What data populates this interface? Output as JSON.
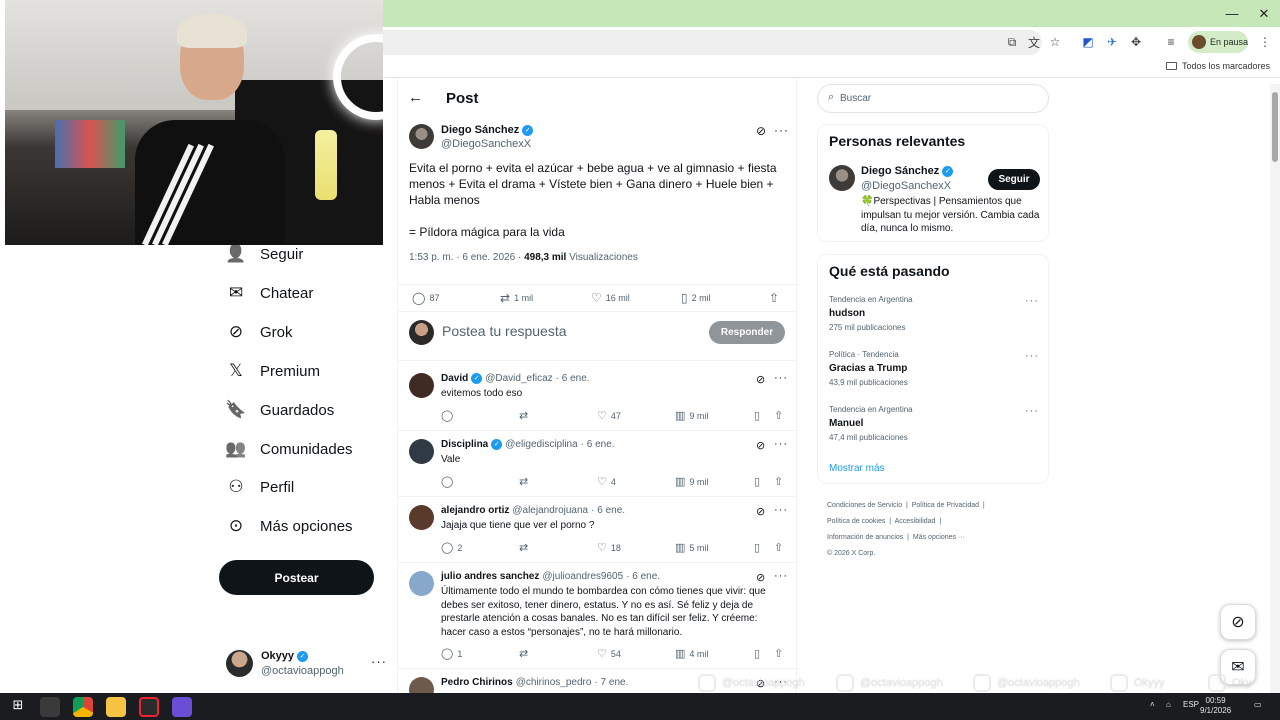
{
  "browser": {
    "profile_status": "En pausa",
    "bookmarks_all": "Todos los marcadores",
    "window_min": "—",
    "window_restore": "❐",
    "window_close": "✕"
  },
  "nav": {
    "items": [
      {
        "label": "Seguir",
        "icon": "add-person-icon"
      },
      {
        "label": "Chatear",
        "icon": "mail-icon"
      },
      {
        "label": "Grok",
        "icon": "grok-icon"
      },
      {
        "label": "Premium",
        "icon": "x-logo-icon"
      },
      {
        "label": "Guardados",
        "icon": "bookmark-icon"
      },
      {
        "label": "Comunidades",
        "icon": "communities-icon"
      },
      {
        "label": "Perfil",
        "icon": "person-icon"
      },
      {
        "label": "Más opciones",
        "icon": "more-circle-icon"
      }
    ],
    "post_button": "Postear",
    "account": {
      "name": "Okyyy",
      "handle": "@octavioappogh"
    }
  },
  "header": {
    "title": "Post"
  },
  "post": {
    "author_name": "Diego Sánchez",
    "author_handle": "@DiegoSanchexX",
    "text": "Evita el porno + evita el azúcar + bebe agua + ve al gimnasio + fiesta menos + Evita el drama + Vístete bien + Gana dinero + Huele bien + Habla menos",
    "text2": "= Píldora mágica para la vida",
    "time": "1:53 p. m. · 6 ene. 2026 · ",
    "views_count": "498,3 mil",
    "views_label": " Visualizaciones",
    "replies": "87",
    "reposts": "1 mil",
    "likes": "16 mil",
    "bookmarks": "2 mil"
  },
  "reply_box": {
    "placeholder": "Postea tu respuesta",
    "button": "Responder"
  },
  "replies": [
    {
      "name": "David",
      "handle": "@David_eficaz",
      "date": "· 6 ene.",
      "text": "evitemos todo eso",
      "replies": "",
      "reposts": "",
      "likes": "47",
      "views": "9 mil"
    },
    {
      "name": "Disciplina",
      "handle": "@eligedisciplina",
      "date": "· 6 ene.",
      "text": "Vale",
      "replies": "",
      "reposts": "",
      "likes": "4",
      "views": "9 mil"
    },
    {
      "name": "alejandro ortiz",
      "handle": "@alejandrojuana",
      "date": "· 6 ene.",
      "text": "Jajaja que tiene que ver el porno ?",
      "replies": "2",
      "reposts": "",
      "likes": "18",
      "views": "5 mil"
    },
    {
      "name": "julio andres sanchez",
      "handle": "@julioandres9605",
      "date": "· 6 ene.",
      "text": "Últimamente todo el mundo te bombardea con cómo tienes que vivir: que debes ser exitoso, tener dinero, estatus. Y no es así. Sé feliz y deja de prestarle atención a cosas banales. No es tan difícil ser feliz. Y créeme: hacer caso a estos “personajes”, no te hará millonario.",
      "replies": "1",
      "reposts": "",
      "likes": "54",
      "views": "4 mil"
    },
    {
      "name": "Pedro Chirinos",
      "handle": "@chirinos_pedro",
      "date": "· 7 ene.",
      "text": "",
      "replies": "",
      "reposts": "",
      "likes": "",
      "views": ""
    }
  ],
  "sidebar": {
    "search_placeholder": "Buscar",
    "relevant": {
      "title": "Personas relevantes",
      "name": "Diego Sánchez",
      "handle": "@DiegoSanchexX",
      "follow": "Seguir",
      "bio": "🍀Perspectivas | Pensamientos que impulsan tu mejor versión. Cambia cada día, nunca lo mismo."
    },
    "trends": {
      "title": "Qué está pasando",
      "items": [
        {
          "context": "Tendencia en Argentina",
          "name": "hudson",
          "posts": "275 mil publicaciones"
        },
        {
          "context": "Política · Tendencia",
          "name": "Gracias a Trump",
          "posts": "43,9 mil publicaciones"
        },
        {
          "context": "Tendencia en Argentina",
          "name": "Manuel",
          "posts": "47,4 mil publicaciones"
        }
      ],
      "show_more": "Mostrar más"
    },
    "footer": [
      "Condiciones de Servicio",
      "Política de Privacidad",
      "Política de cookies",
      "Accesibilidad",
      "Información de anuncios",
      "Más opciones ···",
      "© 2026 X Corp."
    ]
  },
  "overlay": {
    "socials": [
      {
        "icon": "instagram-icon",
        "text": "@octavioappogh"
      },
      {
        "icon": "x-logo-icon",
        "text": "@octavioappogh"
      },
      {
        "icon": "tiktok-icon",
        "text": "@octavioappogh"
      },
      {
        "icon": "youtube-icon",
        "text": "Okyyy"
      },
      {
        "icon": "spotify-icon",
        "text": "Oky"
      }
    ]
  },
  "taskbar": {
    "lang": "ESP",
    "time": "00:59",
    "date": "9/1/2026"
  }
}
